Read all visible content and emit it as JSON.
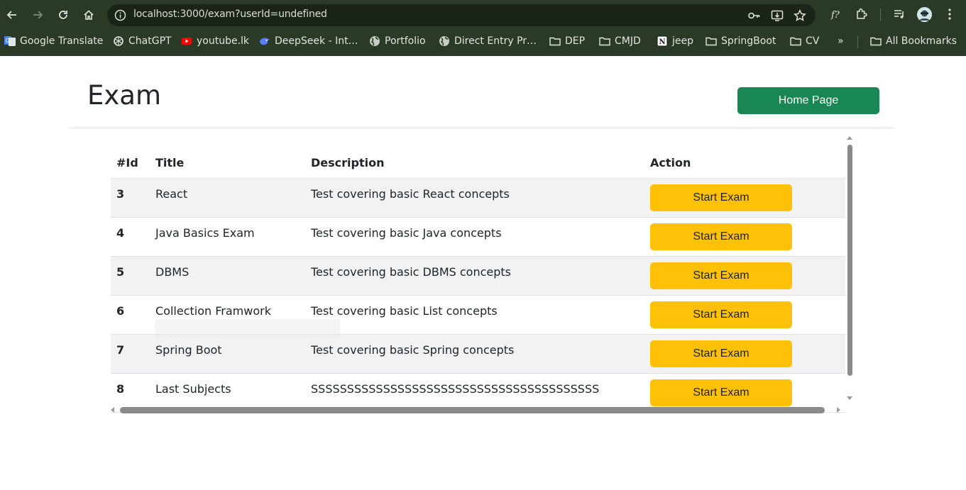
{
  "browser": {
    "url": "localhost:3000/exam?userId=undefined",
    "bookmarks": [
      {
        "label": "Google Translate",
        "icon": "google-translate-icon"
      },
      {
        "label": "ChatGPT",
        "icon": "chatgpt-icon"
      },
      {
        "label": "youtube.lk",
        "icon": "youtube-icon"
      },
      {
        "label": "DeepSeek - Int…",
        "icon": "deepseek-icon"
      },
      {
        "label": "Portfolio",
        "icon": "globe-icon"
      },
      {
        "label": "Direct Entry Pr…",
        "icon": "globe-icon"
      },
      {
        "label": "DEP",
        "icon": "folder-icon"
      },
      {
        "label": "CMJD",
        "icon": "folder-icon"
      },
      {
        "label": "jeep",
        "icon": "notion-icon"
      },
      {
        "label": "SpringBoot",
        "icon": "folder-icon"
      },
      {
        "label": "CV",
        "icon": "folder-icon"
      }
    ],
    "more_label": "»",
    "all_bookmarks_label": "All Bookmarks"
  },
  "page": {
    "title": "Exam",
    "home_button": "Home Page"
  },
  "table": {
    "headers": [
      "#Id",
      "Title",
      "Description",
      "Action"
    ],
    "rows": [
      {
        "id": "3",
        "title": "React",
        "description": "Test covering basic React concepts",
        "action": "Start Exam"
      },
      {
        "id": "4",
        "title": "Java Basics Exam",
        "description": "Test covering basic Java concepts",
        "action": "Start Exam"
      },
      {
        "id": "5",
        "title": "DBMS",
        "description": "Test covering basic DBMS concepts",
        "action": "Start Exam"
      },
      {
        "id": "6",
        "title": "Collection Framwork",
        "description": "Test covering basic List concepts",
        "action": "Start Exam"
      },
      {
        "id": "7",
        "title": "Spring Boot",
        "description": "Test covering basic Spring concepts",
        "action": "Start Exam"
      },
      {
        "id": "8",
        "title": "Last Subjects",
        "description": "SSSSSSSSSSSSSSSSSSSSSSSSSSSSSSSSSSSSSSSS",
        "action": "Start Exam"
      }
    ]
  },
  "colors": {
    "chrome_bg": "#2b3a26",
    "home_button_bg": "#198754",
    "start_button_bg": "#ffc107"
  }
}
